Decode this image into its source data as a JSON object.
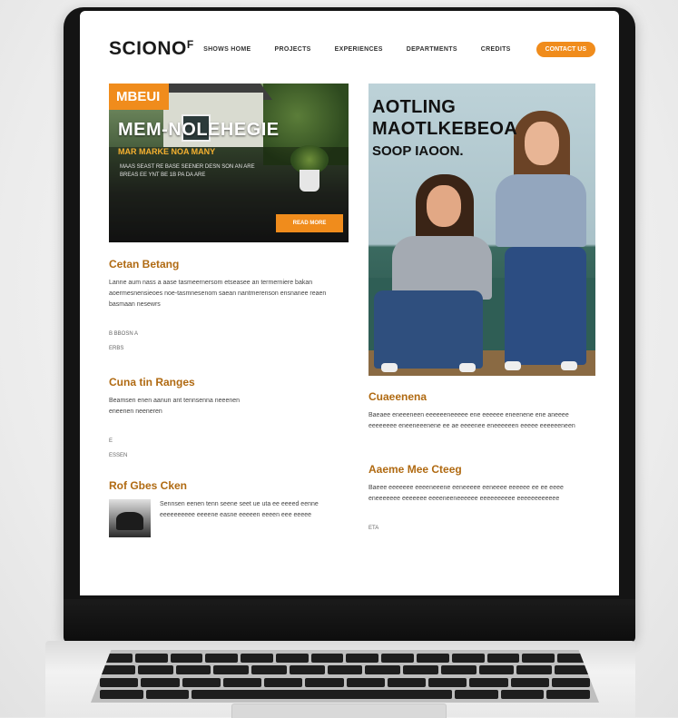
{
  "site": {
    "logo": "SCIONO",
    "logo_mark": "F",
    "nav": [
      "SHOWS HOME",
      "PROJECTS",
      "EXPERIENCES",
      "DEPARTMENTS",
      "CREDITS"
    ],
    "cta": "CONTACT US"
  },
  "hero": {
    "tag": "MBEUI",
    "title": "MEM-NOLEHEGIE",
    "subtitle": "MAR MARKE NOA MANY",
    "body": "MAAS SEAST RE BASE SEENER DESN SON AN ARE BREAS EE YNT BE 1B PA DA ARE",
    "button": "READ MORE"
  },
  "section1": {
    "title": "Cetan Betang",
    "text": "Lanne aum nass a aase tasmeernersom etseasee an termerniere bakan aoermesnensieoes noe-tasmnesenom saean nantmerenson ensnanee reaen basmaan nesewrs",
    "meta1": "B  BBOSN A",
    "meta2": "ERBS"
  },
  "section2": {
    "title": "Cuna tin Ranges",
    "text": "Beamsen enen aanun ant tennsenna neeenen eneenen neeneren",
    "meta1": "E",
    "meta2": "ESSEN"
  },
  "section3": {
    "title": "Rof Gbes Cken",
    "text": "Sennsen eenen tenn seene seet ue uta ee eeeed eenne eeeeeeeeee eeeene easne eeeeen eeeen eee eeeee"
  },
  "feature": {
    "title_line1": "AOTLING",
    "title_line2": "MAOTLKEBEOA",
    "subtitle": "SOOP IAOON."
  },
  "section4": {
    "title": "Cuaeenena",
    "text": "Baeaee eneeeneen eeeeeeneeeee ene eeeeee eneenene ene aneeee eeeeeeee eneeneeenene ee ae eeeenee eneeeeeen eeeee eeeeeeneen"
  },
  "section5": {
    "title": "Aaeme Mee Cteeg",
    "text": "Baeee eeeeeee eeeeneeene eeneeeee eeneeee eeeeee ee ee eeee eneeeeeee eeeeeee eeeeneeneeeeee eeeeeeeeee eeeeeeeeeeee",
    "meta": "ETA"
  }
}
